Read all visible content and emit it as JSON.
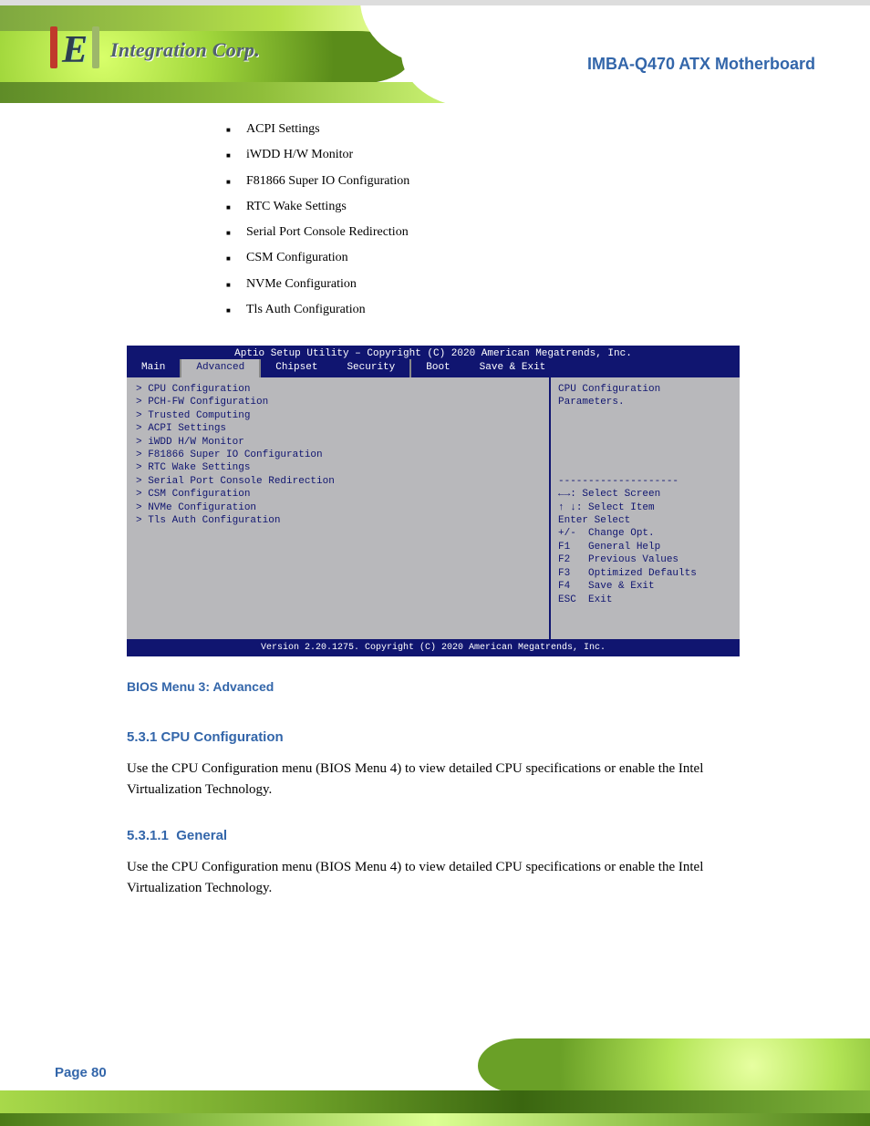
{
  "logo_text": "Integration Corp.",
  "product_title": "IMBA-Q470 ATX Motherboard",
  "bullets": [
    "ACPI Settings",
    "iWDD H/W Monitor",
    "F81866 Super IO Configuration",
    "RTC Wake Settings",
    "Serial Port Console Redirection",
    "CSM Configuration",
    "NVMe Configuration",
    "Tls Auth Configuration"
  ],
  "bios": {
    "title": "Aptio Setup Utility – Copyright (C) 2020 American Megatrends, Inc.",
    "tabs": [
      "Main",
      "Advanced",
      "Chipset",
      "Security",
      "Boot",
      "Save & Exit"
    ],
    "active_tab_index": 1,
    "left": [
      {
        "arrow": true,
        "text": "CPU Configuration"
      },
      {
        "arrow": true,
        "text": "PCH-FW Configuration"
      },
      {
        "arrow": true,
        "text": "Trusted Computing"
      },
      {
        "arrow": true,
        "text": "ACPI Settings"
      },
      {
        "arrow": true,
        "text": "iWDD H/W Monitor"
      },
      {
        "arrow": true,
        "text": "F81866 Super IO Configuration"
      },
      {
        "arrow": true,
        "text": "RTC Wake Settings"
      },
      {
        "arrow": true,
        "text": "Serial Port Console Redirection"
      },
      {
        "arrow": true,
        "text": "CSM Configuration"
      },
      {
        "arrow": true,
        "text": "NVMe Configuration"
      },
      {
        "arrow": true,
        "text": "Tls Auth Configuration"
      }
    ],
    "right_desc": [
      "CPU Configuration",
      "Parameters."
    ],
    "right_help": [
      {
        "key": "←→",
        "label": ": Select Screen"
      },
      {
        "key": "↑ ↓",
        "label": ": Select Item"
      },
      {
        "key": "Enter",
        "label": "Select"
      },
      {
        "key": "+/-",
        "label": "Change Opt."
      },
      {
        "key": "F1",
        "label": "General Help"
      },
      {
        "key": "F2",
        "label": "Previous Values"
      },
      {
        "key": "F3",
        "label": "Optimized Defaults"
      },
      {
        "key": "F4",
        "label": "Save & Exit"
      },
      {
        "key": "ESC",
        "label": "Exit"
      }
    ],
    "footer": "Version 2.20.1275. Copyright (C) 2020 American Megatrends, Inc."
  },
  "caption": "BIOS Menu 3: Advanced",
  "sections": {
    "s1_num": "5.3.1  CPU Configuration",
    "s1_body": "Use the CPU Configuration menu (BIOS Menu 4) to view detailed CPU specifications or enable the Intel Virtualization Technology.",
    "s2_num": "5.3.1.1",
    "s2_title": "General",
    "s2_body": "Use the CPU Configuration menu (BIOS Menu 4) to view detailed CPU specifications or enable the Intel Virtualization Technology."
  },
  "page_label": "Page 80"
}
